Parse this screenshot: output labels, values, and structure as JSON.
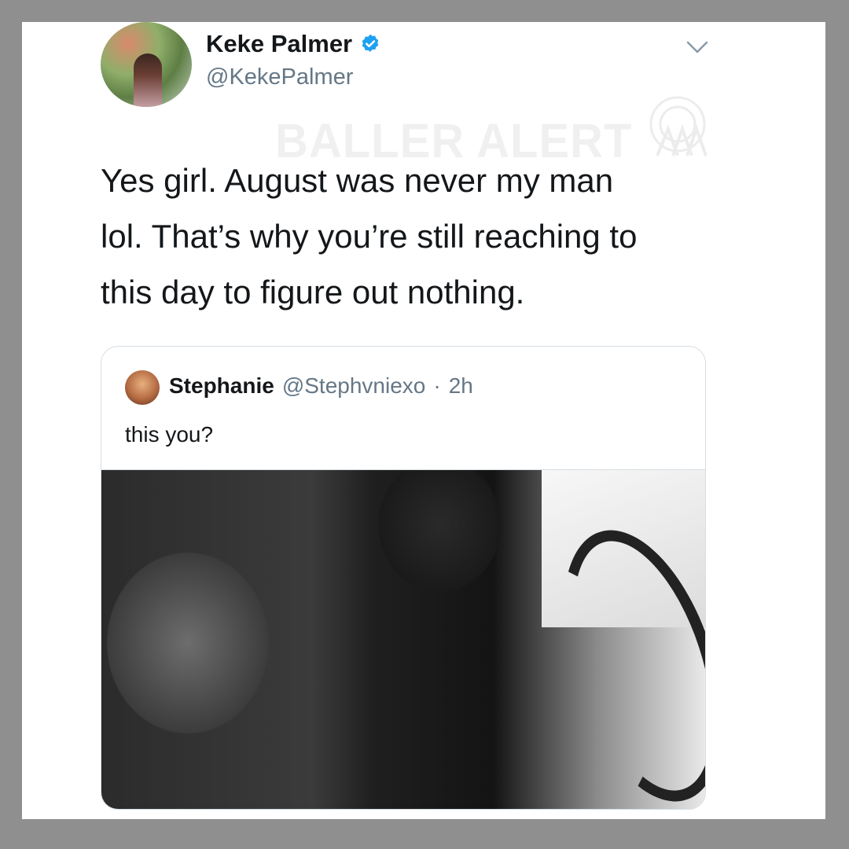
{
  "tweet": {
    "author_name": "Keke Palmer",
    "author_handle": "@KekePalmer",
    "text_lines": [
      "Yes girl. August was never my man",
      "lol. That’s why you’re still reaching to",
      "this day to figure out nothing."
    ]
  },
  "watermark": {
    "text": "BALLER ALERT"
  },
  "quoted_tweet": {
    "author_name": "Stephanie",
    "author_handle": "@Stephvniexo",
    "separator": "·",
    "time": "2h",
    "text": "this you?"
  },
  "colors": {
    "frame_border": "#8f8f8f",
    "text_primary": "#14171a",
    "text_secondary": "#657786",
    "verified_badge": "#1da1f2"
  },
  "icons": [
    "verified-badge-icon",
    "chevron-down-icon",
    "watermark-logo-icon"
  ]
}
